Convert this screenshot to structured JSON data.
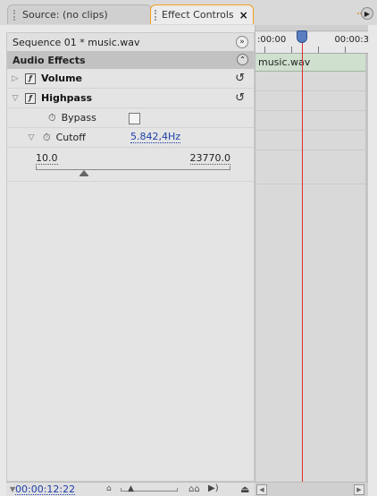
{
  "tabs": {
    "source_label": "Source: (no clips)",
    "effect_controls_label": "Effect Controls",
    "close_glyph": "×"
  },
  "panel": {
    "sequence_label": "Sequence 01 * music.wav",
    "section_title": "Audio Effects",
    "effects": [
      {
        "name": "Volume",
        "expanded": false
      },
      {
        "name": "Highpass",
        "expanded": true
      }
    ],
    "bypass_label": "Bypass",
    "bypass_checked": false,
    "cutoff_label": "Cutoff",
    "cutoff_value": "5.842,4Hz",
    "slider": {
      "min_label": "10.0",
      "max_label": "23770.0"
    }
  },
  "timeline": {
    "time_start": ":00:00",
    "time_end": "00:00:3",
    "clip_name": "music.wav"
  },
  "bottom": {
    "timecode": "00:00:12:22"
  },
  "colors": {
    "accent_tab_border": "#f0a020",
    "link_blue": "#1e3ea8",
    "playhead": "#e03030",
    "clip_green": "#cfe0cf"
  }
}
